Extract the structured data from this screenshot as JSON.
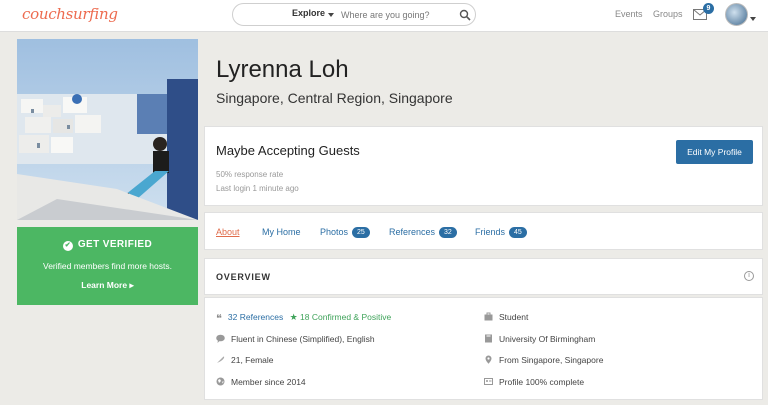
{
  "brand": {
    "logo_text": "couchsurfing",
    "accent": "#ed6b4f",
    "primary": "#2b6ea4",
    "success": "#4cb763"
  },
  "search": {
    "mode_label": "Explore",
    "placeholder": "Where are you going?"
  },
  "nav": {
    "events": "Events",
    "groups": "Groups",
    "mail_count": "9"
  },
  "verify": {
    "title": "GET VERIFIED",
    "description": "Verified members find more hosts.",
    "learn_more": "Learn More"
  },
  "profile": {
    "name": "Lyrenna Loh",
    "location": "Singapore, Central Region, Singapore"
  },
  "status": {
    "title": "Maybe Accepting Guests",
    "response_rate": "50% response rate",
    "last_login": "Last login 1 minute ago",
    "edit_button": "Edit My Profile"
  },
  "tabs": [
    {
      "label": "About",
      "active": true
    },
    {
      "label": "My Home"
    },
    {
      "label": "Photos",
      "count": "25"
    },
    {
      "label": "References",
      "count": "32"
    },
    {
      "label": "Friends",
      "count": "45"
    }
  ],
  "overview": {
    "title": "OVERVIEW",
    "references": "32 References",
    "confirmed": "18 Confirmed & Positive",
    "languages": "Fluent in Chinese (Simplified), English",
    "age_gender": "21, Female",
    "member_since": "Member since 2014",
    "occupation": "Student",
    "education": "University Of Birmingham",
    "hometown": "From Singapore, Singapore",
    "profile_complete": "Profile 100% complete"
  }
}
